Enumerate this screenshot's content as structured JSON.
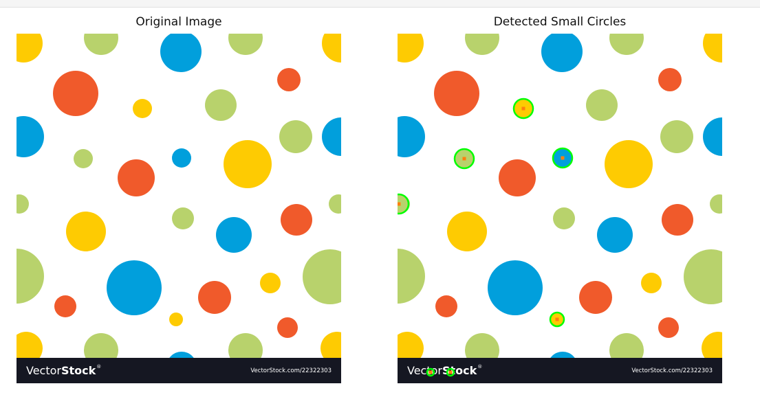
{
  "figure": {
    "left_title": "Original Image",
    "right_title": "Detected Small Circles"
  },
  "watermark": {
    "brand_light": "Vector",
    "brand_bold": "Stock",
    "registered": "®",
    "url": "VectorStock.com/22322303"
  },
  "colors": {
    "background": "#ffffff",
    "orange": "#f05a2b",
    "yellow": "#fecb02",
    "green": "#b8d26c",
    "blue": "#019fdc",
    "banner": "#151722",
    "detection_ring": "#00ff00",
    "detection_center": "#ff7f0e"
  },
  "detections_count": 7
}
